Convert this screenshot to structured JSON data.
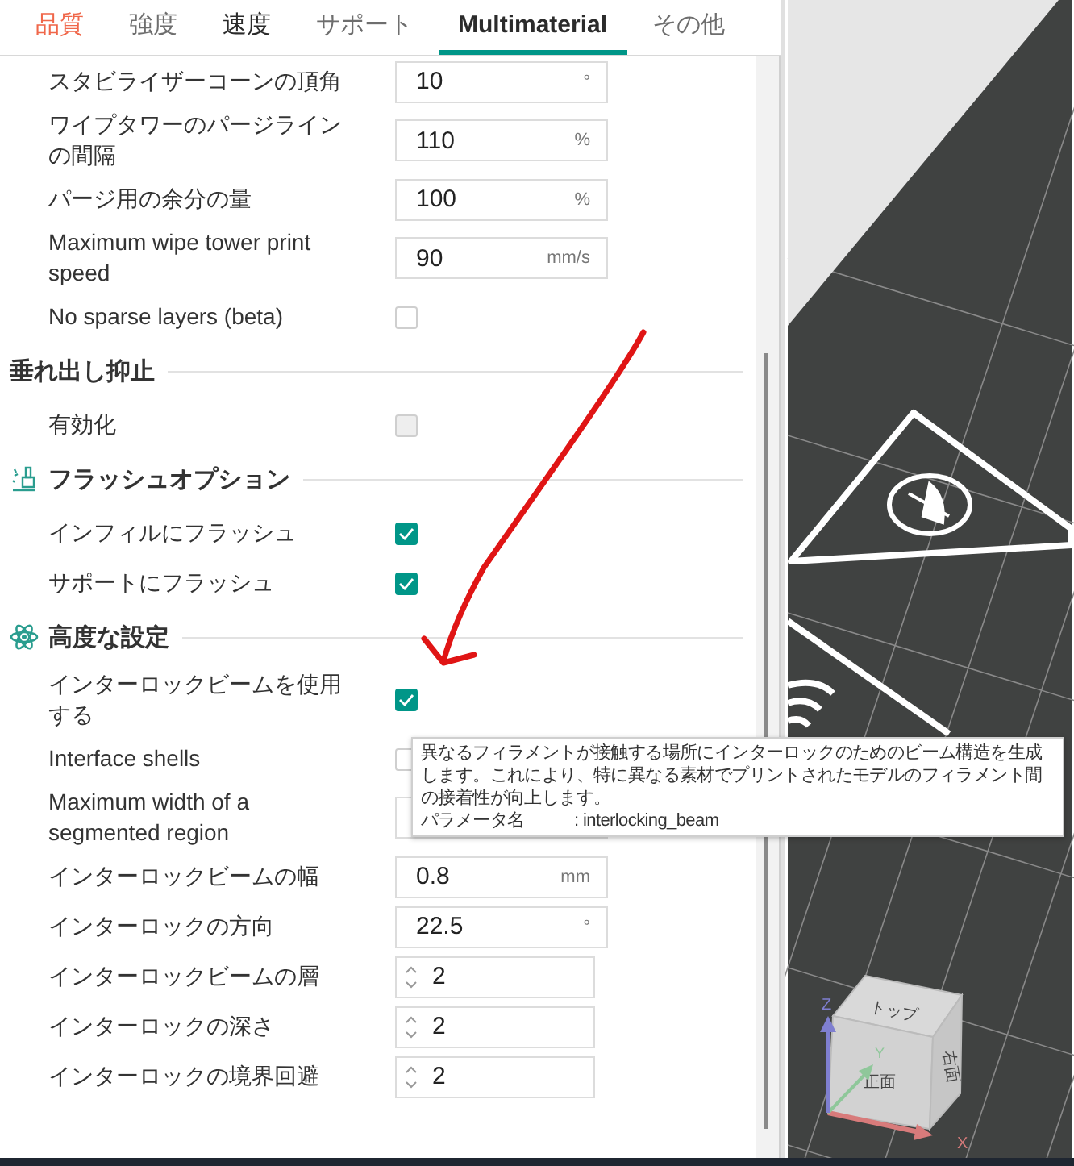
{
  "tabs": [
    {
      "label": "品質",
      "selected": false,
      "color": "#f0674a"
    },
    {
      "label": "強度",
      "selected": false,
      "color": "#6e6e6e"
    },
    {
      "label": "速度",
      "selected": false,
      "color": "#2b2b2b"
    },
    {
      "label": "サポート",
      "selected": false,
      "color": "#6e6e6e"
    },
    {
      "label": "Multimaterial",
      "selected": true,
      "color": "#2b2b2b"
    },
    {
      "label": "その他",
      "selected": false,
      "color": "#6e6e6e"
    }
  ],
  "groups": [
    {
      "kind": "continued",
      "rows": [
        {
          "kind": "number",
          "label": "スタビライザーコーンの頂角",
          "value": "10",
          "unit": "°"
        },
        {
          "kind": "number",
          "label": "ワイプタワーのパージラインの間隔",
          "value": "110",
          "unit": "%"
        },
        {
          "kind": "number",
          "label": "パージ用の余分の量",
          "value": "100",
          "unit": "%"
        },
        {
          "kind": "number",
          "label": "Maximum wipe tower print speed",
          "value": "90",
          "unit": "mm/s"
        },
        {
          "kind": "checkbox",
          "label": "No sparse layers (beta)",
          "checked": false,
          "disabled": false
        }
      ]
    },
    {
      "kind": "plain",
      "title": "垂れ出し抑止",
      "rows": [
        {
          "kind": "checkbox",
          "label": "有効化",
          "checked": false,
          "disabled": true
        }
      ]
    },
    {
      "kind": "flush",
      "title": "フラッシュオプション",
      "rows": [
        {
          "kind": "checkbox",
          "label": "インフィルにフラッシュ",
          "checked": true,
          "disabled": false
        },
        {
          "kind": "checkbox",
          "label": "サポートにフラッシュ",
          "checked": true,
          "disabled": false
        }
      ]
    },
    {
      "kind": "advanced",
      "title": "高度な設定",
      "rows": [
        {
          "kind": "checkbox",
          "label": "インターロックビームを使用する",
          "checked": true,
          "disabled": false
        },
        {
          "kind": "checkbox",
          "label": "Interface shells",
          "checked": false,
          "disabled": false
        },
        {
          "kind": "number",
          "label": "Maximum width of a segmented region"
        },
        {
          "kind": "number",
          "label": "インターロックビームの幅",
          "value": "0.8",
          "unit": "mm"
        },
        {
          "kind": "number",
          "label": "インターロックの方向",
          "value": "22.5",
          "unit": "°"
        },
        {
          "kind": "spin",
          "label": "インターロックビームの層",
          "value": "2"
        },
        {
          "kind": "spin",
          "label": "インターロックの深さ",
          "value": "2"
        },
        {
          "kind": "spin",
          "label": "インターロックの境界回避",
          "value": "2"
        }
      ]
    }
  ],
  "tooltip": {
    "description": "異なるフィラメントが接触する場所にインターロックのためのビーム構造を生成します。これにより、特に異なる素材でプリントされたモデルのフィラメント間の接着性が向上します。",
    "param_label": "パラメータ名",
    "param_value": ": interlocking_beam"
  },
  "viewport": {
    "view_cube": {
      "faces": [
        "トップ",
        "正面",
        "右面"
      ],
      "axes": [
        "X",
        "Y",
        "Z"
      ]
    }
  }
}
